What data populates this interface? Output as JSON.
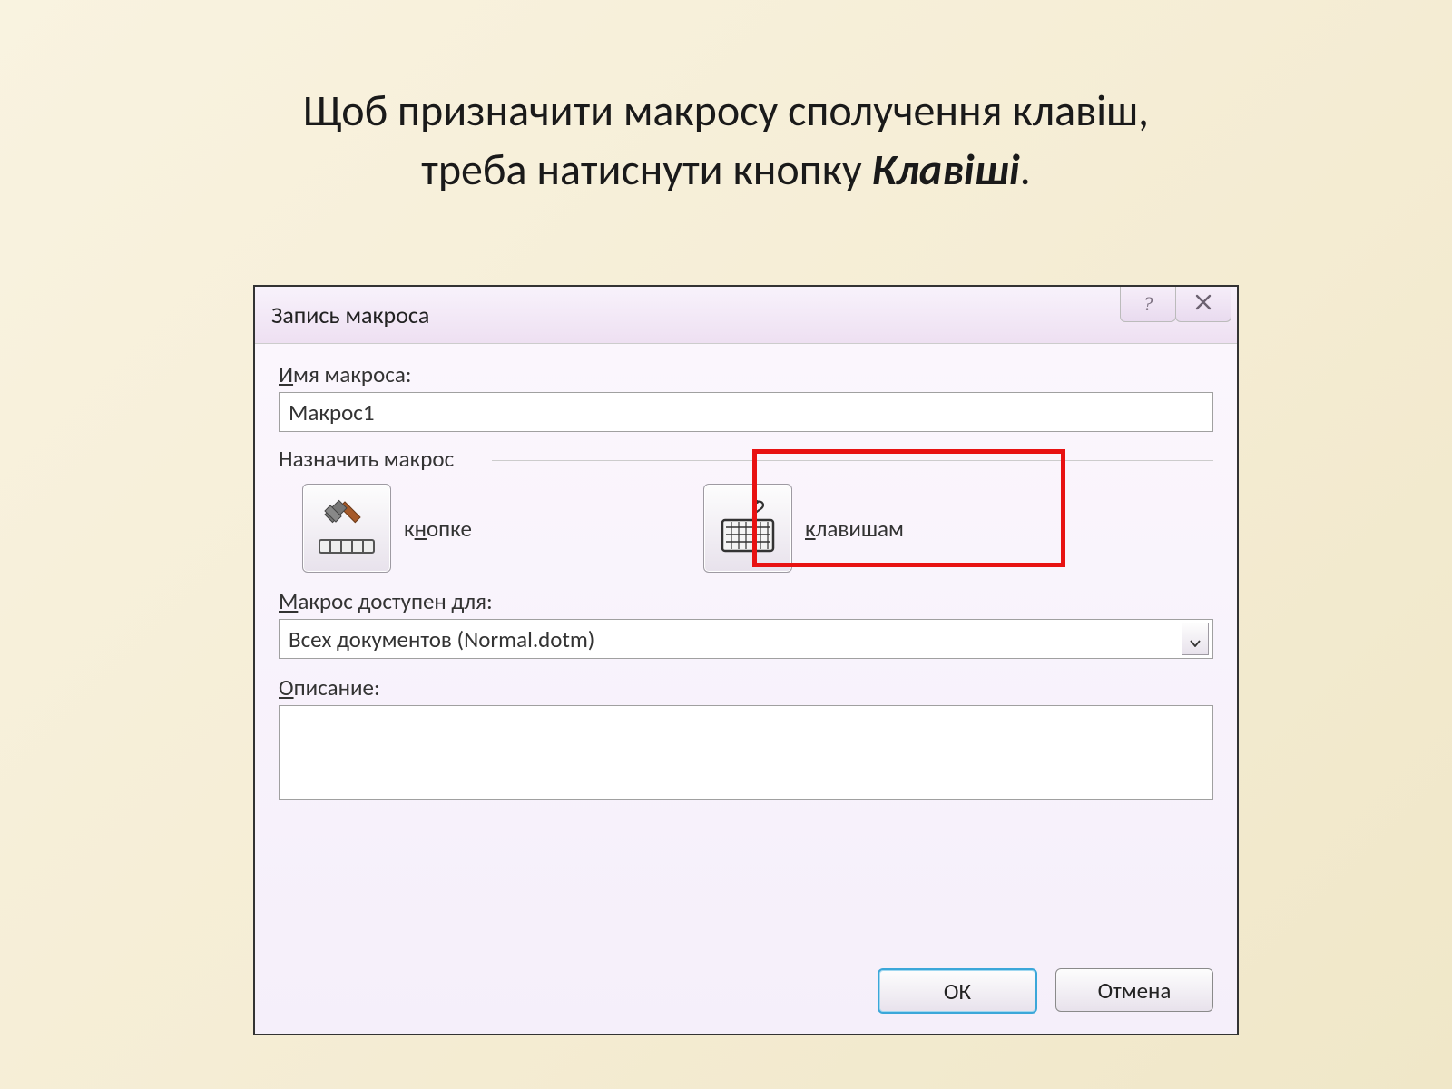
{
  "heading": {
    "line1": "Щоб призначити макросу сполучення клавіш,",
    "line2_prefix": "треба натиснути кнопку ",
    "line2_emph": "Клавіші",
    "line2_suffix": "."
  },
  "dialog": {
    "title": "Запись макроса",
    "help_glyph": "?",
    "close_glyph": "✕",
    "name_label_u": "И",
    "name_label_rest": "мя макроса:",
    "name_value": "Макрос1",
    "assign_label": "Назначить макрос",
    "assign_button_u": "н",
    "assign_button_pre": "к",
    "assign_button_post": "опке",
    "assign_keys_u": "к",
    "assign_keys_post": "лавишам",
    "available_label_u": "М",
    "available_label_rest": "акрос доступен для:",
    "available_value": "Всех документов (Normal.dotm)",
    "description_label_u": "О",
    "description_label_rest": "писание:",
    "ok": "ОК",
    "cancel": "Отмена"
  }
}
